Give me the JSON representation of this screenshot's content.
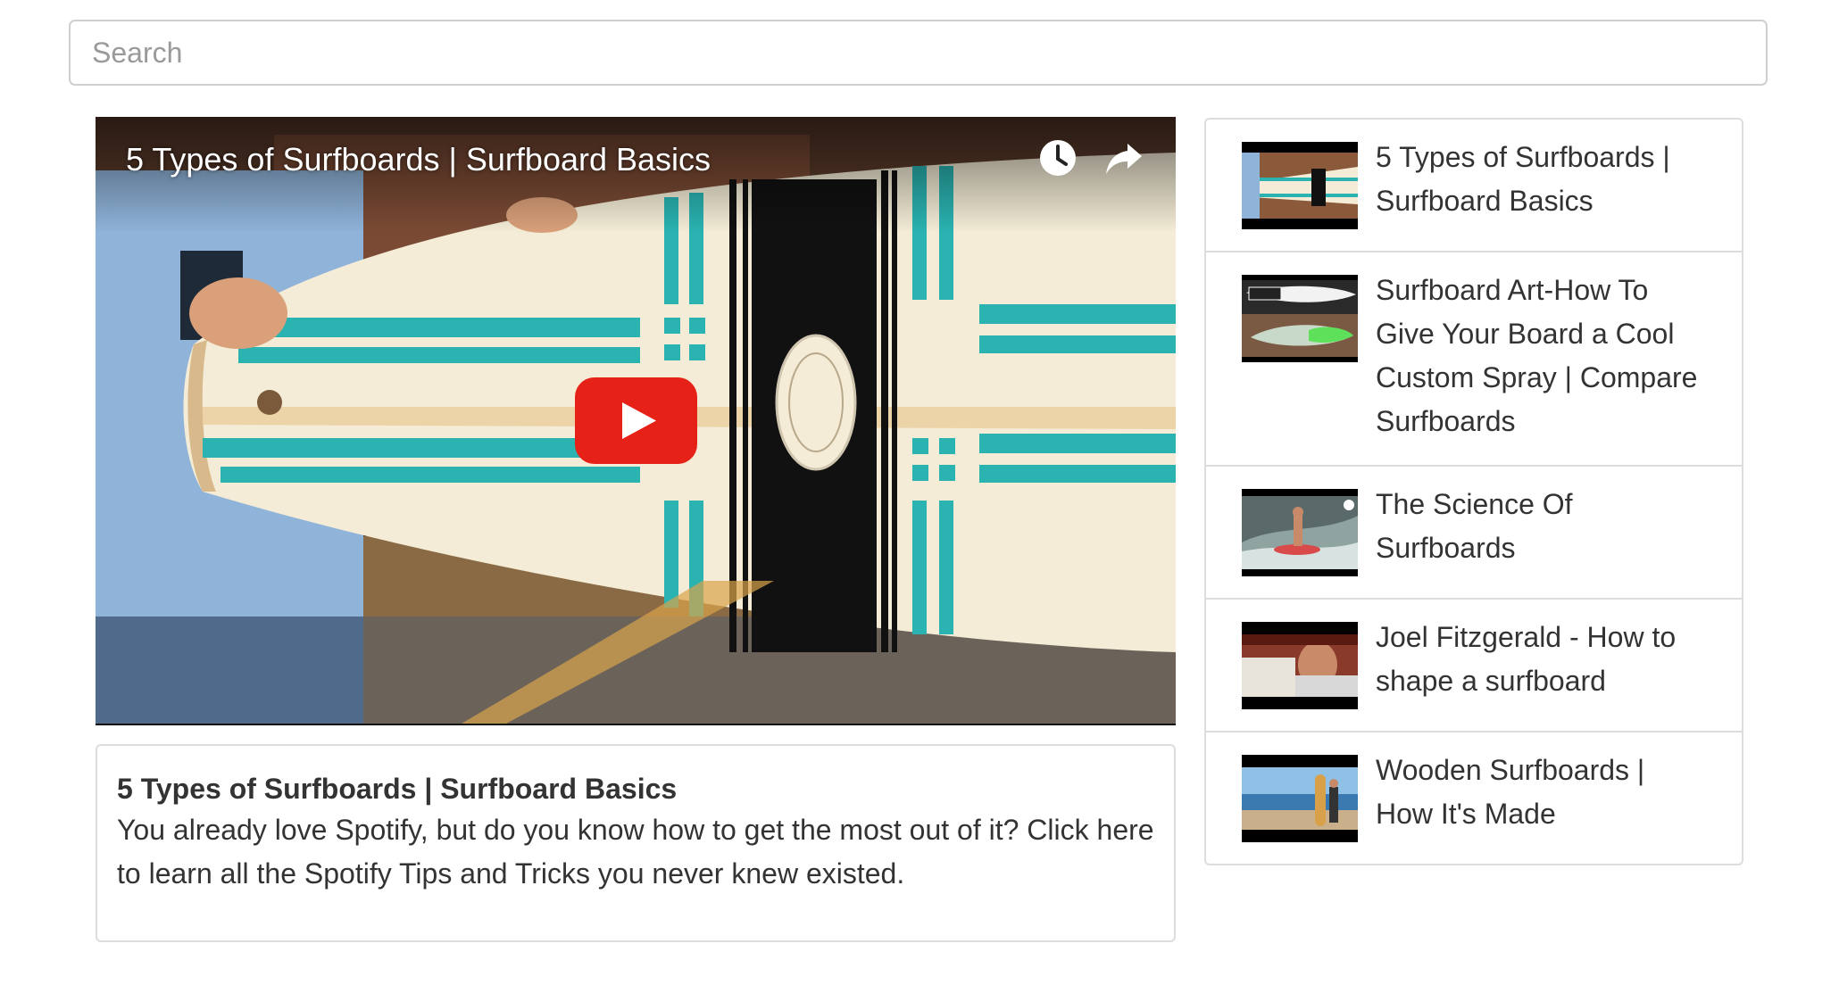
{
  "search": {
    "placeholder": "Search"
  },
  "player": {
    "title": "5 Types of Surfboards | Surfboard Basics",
    "icons": {
      "watch_later": "clock-icon",
      "share": "share-arrow-icon",
      "play": "play-icon"
    },
    "colors": {
      "play_button": "#e62117",
      "board_stripe": "#2ab3b1"
    }
  },
  "detail": {
    "title": "5 Types of Surfboards | Surfboard Basics",
    "description": "You already love Spotify, but do you know how to get the most out of it? Click here to learn all the Spotify Tips and Tricks you never knew existed."
  },
  "playlist": {
    "items": [
      {
        "title": "5 Types of Surfboards | Surfboard Basics"
      },
      {
        "title": "Surfboard Art-How To Give Your Board a Cool Custom Spray | Compare Surfboards"
      },
      {
        "title": "The Science Of Surfboards"
      },
      {
        "title": "Joel Fitzgerald - How to shape a surfboard"
      },
      {
        "title": "Wooden Surfboards | How It's Made"
      }
    ]
  }
}
